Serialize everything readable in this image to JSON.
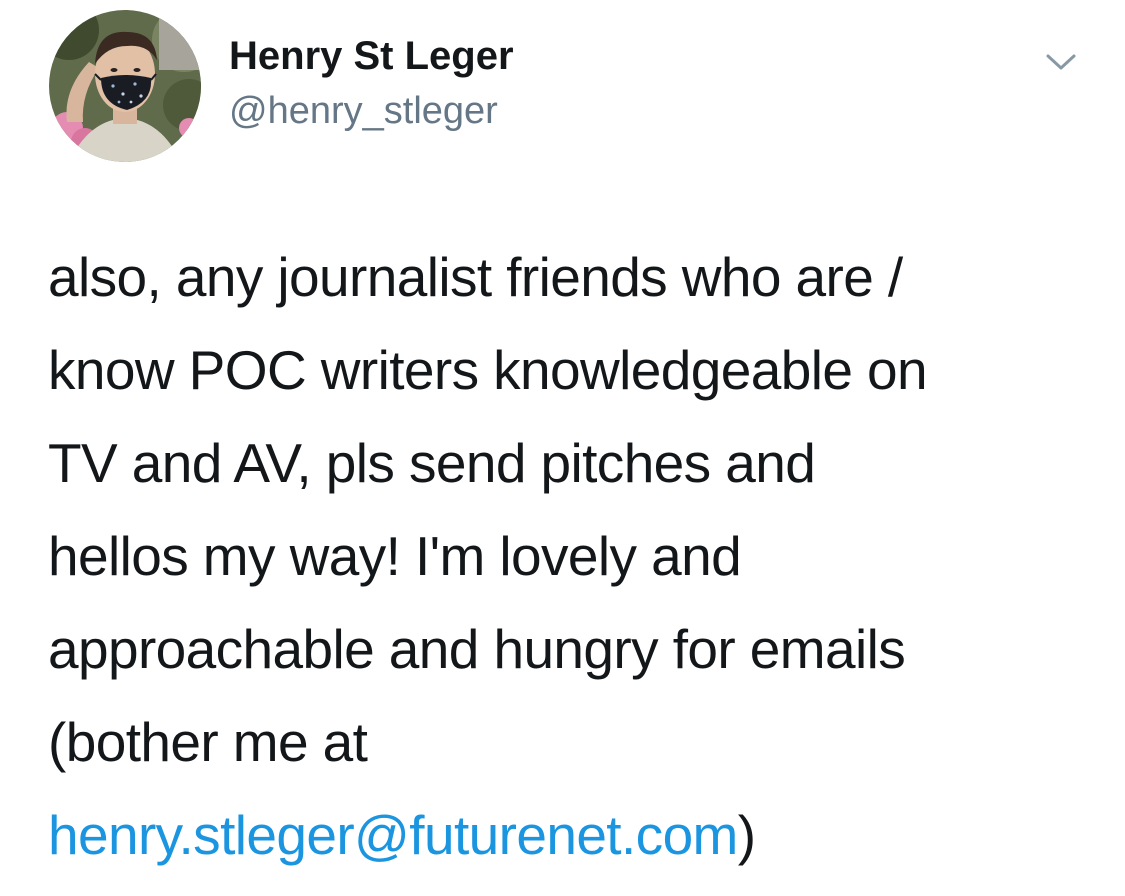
{
  "author": {
    "display_name": "Henry St Leger",
    "handle": "@henry_stleger"
  },
  "header": {
    "menu_icon": "chevron-down-icon"
  },
  "tweet": {
    "lines": [
      "also, any journalist friends who are /",
      "know POC writers knowledgeable on",
      "TV and AV, pls send pitches and",
      "hellos my way! I'm lovely and",
      "approachable and hungry for emails",
      "(bother me at"
    ],
    "email_link": "henry.stleger@futurenet.com",
    "closing": ")"
  },
  "colors": {
    "text": "#14171a",
    "secondary": "#657786",
    "link": "#1b95e0",
    "background": "#ffffff"
  }
}
